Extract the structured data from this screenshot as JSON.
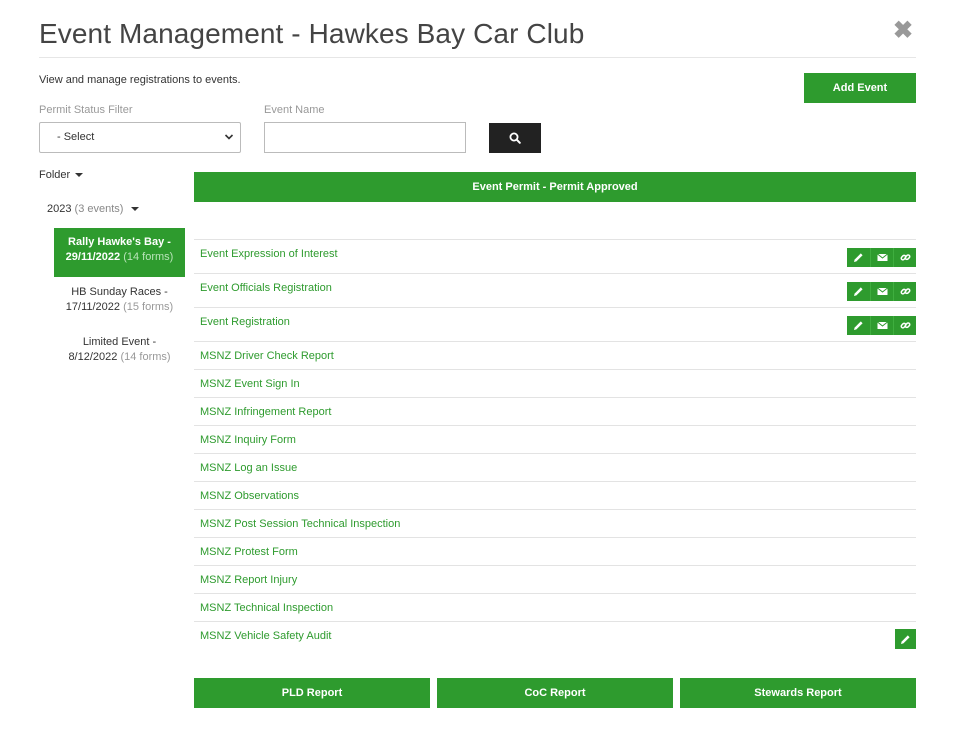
{
  "header": {
    "title": "Event Management - Hawkes Bay Car Club",
    "close_icon": "close-icon"
  },
  "toolbar": {
    "subtitle": "View and manage registrations to events.",
    "add_event_label": "Add Event"
  },
  "filters": {
    "permit_status_label": "Permit Status Filter",
    "permit_status_value": "- Select",
    "event_name_label": "Event Name",
    "event_name_value": "",
    "search_icon": "search-icon"
  },
  "sidebar": {
    "folder_label": "Folder",
    "year": {
      "label": "2023",
      "count": "(3 events)"
    },
    "events": [
      {
        "name": "Rally Hawke's Bay - 29/11/2022",
        "forms": "(14 forms)",
        "active": true
      },
      {
        "name": "HB Sunday Races - 17/11/2022",
        "forms": "(15 forms)",
        "active": false
      },
      {
        "name": "Limited Event - 8/12/2022",
        "forms": "(14 forms)",
        "active": false
      }
    ]
  },
  "main": {
    "permit_banner": "Event Permit - Permit Approved",
    "forms": [
      {
        "name": "Event Expression of Interest",
        "actions": [
          "pencil-icon",
          "envelope-icon",
          "link-icon"
        ]
      },
      {
        "name": "Event Officials Registration",
        "actions": [
          "pencil-icon",
          "envelope-icon",
          "link-icon"
        ]
      },
      {
        "name": "Event Registration",
        "actions": [
          "pencil-icon",
          "envelope-icon",
          "link-icon"
        ]
      },
      {
        "name": "MSNZ Driver Check Report"
      },
      {
        "name": "MSNZ Event Sign In"
      },
      {
        "name": "MSNZ Infringement Report"
      },
      {
        "name": "MSNZ Inquiry Form"
      },
      {
        "name": "MSNZ Log an Issue"
      },
      {
        "name": "MSNZ Observations"
      },
      {
        "name": "MSNZ Post Session Technical Inspection"
      },
      {
        "name": "MSNZ Protest Form"
      },
      {
        "name": "MSNZ Report Injury"
      },
      {
        "name": "MSNZ Technical Inspection"
      },
      {
        "name": "MSNZ Vehicle Safety Audit",
        "actions": [
          "pencil-icon"
        ]
      }
    ],
    "reports": {
      "pld_label": "PLD Report",
      "coc_label": "CoC Report",
      "stewards_label": "Stewards Report"
    }
  },
  "colors": {
    "accent": "#2e9b2e",
    "dark_button": "#222222"
  }
}
